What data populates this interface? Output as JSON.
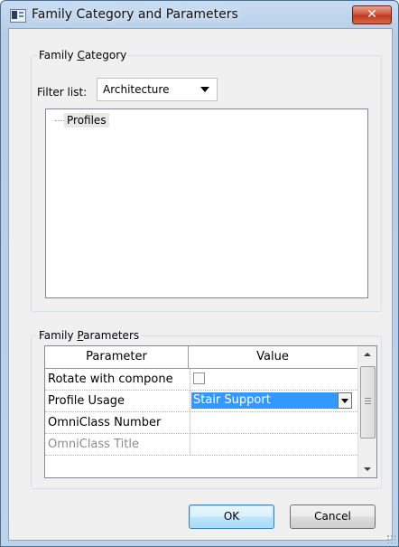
{
  "window": {
    "title": "Family Category and Parameters",
    "close_glyph": "✕"
  },
  "family_category": {
    "label_prefix": "Family ",
    "label_mnemonic": "C",
    "label_suffix": "ategory",
    "filter_label": "Filter list:",
    "filter_value": "Architecture",
    "tree_items": [
      "Profiles"
    ]
  },
  "family_parameters": {
    "label_prefix": "Family ",
    "label_mnemonic": "P",
    "label_suffix": "arameters",
    "columns": [
      "Parameter",
      "Value"
    ],
    "rows": [
      {
        "parameter": "Rotate with compone",
        "value_type": "checkbox",
        "checked": false,
        "enabled": true
      },
      {
        "parameter": "Profile Usage",
        "value_type": "dropdown",
        "value": "Stair Support",
        "enabled": true
      },
      {
        "parameter": "OmniClass Number",
        "value": "",
        "enabled": true
      },
      {
        "parameter": "OmniClass Title",
        "value": "",
        "enabled": false
      }
    ]
  },
  "buttons": {
    "ok": "OK",
    "cancel": "Cancel"
  },
  "colors": {
    "selection": "#3399ff",
    "close_button": "#c7452b",
    "title_bar": "#bcd3ec"
  }
}
